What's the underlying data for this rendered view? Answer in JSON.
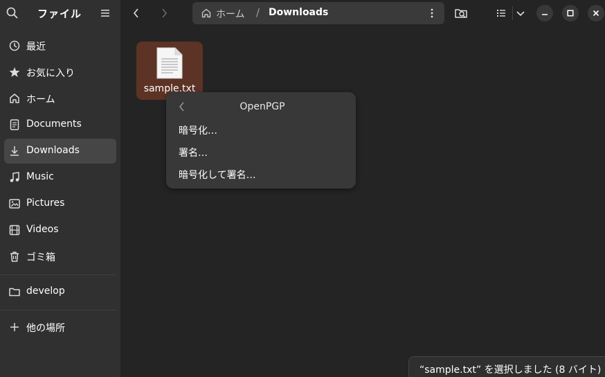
{
  "sidebar": {
    "title": "ファイル",
    "places": [
      {
        "label": "最近",
        "icon": "clock-icon"
      },
      {
        "label": "お気に入り",
        "icon": "star-icon"
      },
      {
        "label": "ホーム",
        "icon": "home-icon"
      },
      {
        "label": "Documents",
        "icon": "document-icon"
      },
      {
        "label": "Downloads",
        "icon": "download-icon",
        "active": true
      },
      {
        "label": "Music",
        "icon": "music-icon"
      },
      {
        "label": "Pictures",
        "icon": "picture-icon"
      },
      {
        "label": "Videos",
        "icon": "video-icon"
      },
      {
        "label": "ゴミ箱",
        "icon": "trash-icon"
      }
    ],
    "bookmarks": [
      {
        "label": "develop",
        "icon": "folder-icon"
      }
    ],
    "other_locations": {
      "label": "他の場所",
      "icon": "plus-icon"
    }
  },
  "pathbar": {
    "home": "ホーム",
    "separator": "/",
    "current": "Downloads"
  },
  "files": [
    {
      "name": "sample.txt",
      "selected": true
    }
  ],
  "context_menu": {
    "title": "OpenPGP",
    "items": [
      "暗号化…",
      "署名…",
      "暗号化して署名…"
    ]
  },
  "status": {
    "text": "“sample.txt” を選択しました (8 バイト)"
  },
  "colors": {
    "sidebar_bg": "#303030",
    "content_bg": "#242424",
    "selection": "#5c3325",
    "menu_bg": "#383838"
  }
}
